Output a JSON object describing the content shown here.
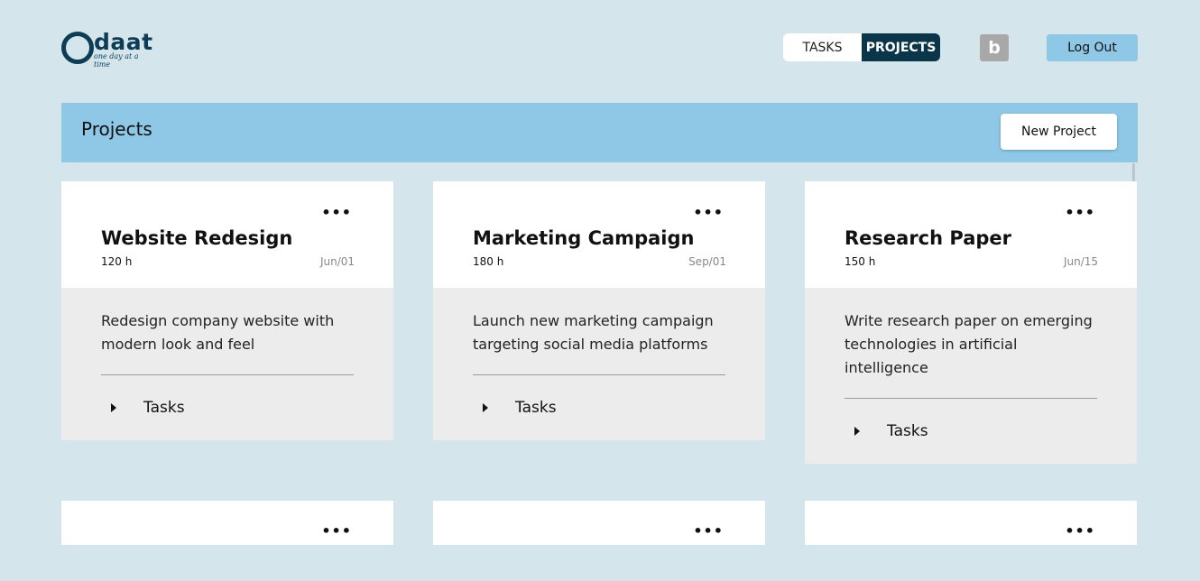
{
  "header": {
    "logo_text": "daat",
    "logo_sub": "one day at a time",
    "view_toggle": {
      "tasks_label": "TASKS",
      "projects_label": "PROJECTS",
      "active": "PROJECTS"
    },
    "avatar_letter": "b",
    "logout_label": "Log Out"
  },
  "banner": {
    "title": "Projects",
    "new_project_label": "New Project"
  },
  "colors": {
    "accent": "#8fc8e6",
    "dark": "#0b3549",
    "background": "#d5e5ec"
  },
  "projects": [
    {
      "title": "Website Redesign",
      "hours": "120 h",
      "date": "Jun/01",
      "description": "Redesign company website with modern look and feel",
      "tasks_label": "Tasks",
      "menu": "•••"
    },
    {
      "title": "Marketing Campaign",
      "hours": "180 h",
      "date": "Sep/01",
      "description": "Launch new marketing campaign targeting social media platforms",
      "tasks_label": "Tasks",
      "menu": "•••"
    },
    {
      "title": "Research Paper",
      "hours": "150 h",
      "date": "Jun/15",
      "description": "Write research paper on emerging technologies in artificial intelligence",
      "tasks_label": "Tasks",
      "menu": "•••"
    }
  ],
  "partial_cards": [
    {
      "menu": "•••"
    },
    {
      "menu": "•••"
    },
    {
      "menu": "•••"
    }
  ]
}
